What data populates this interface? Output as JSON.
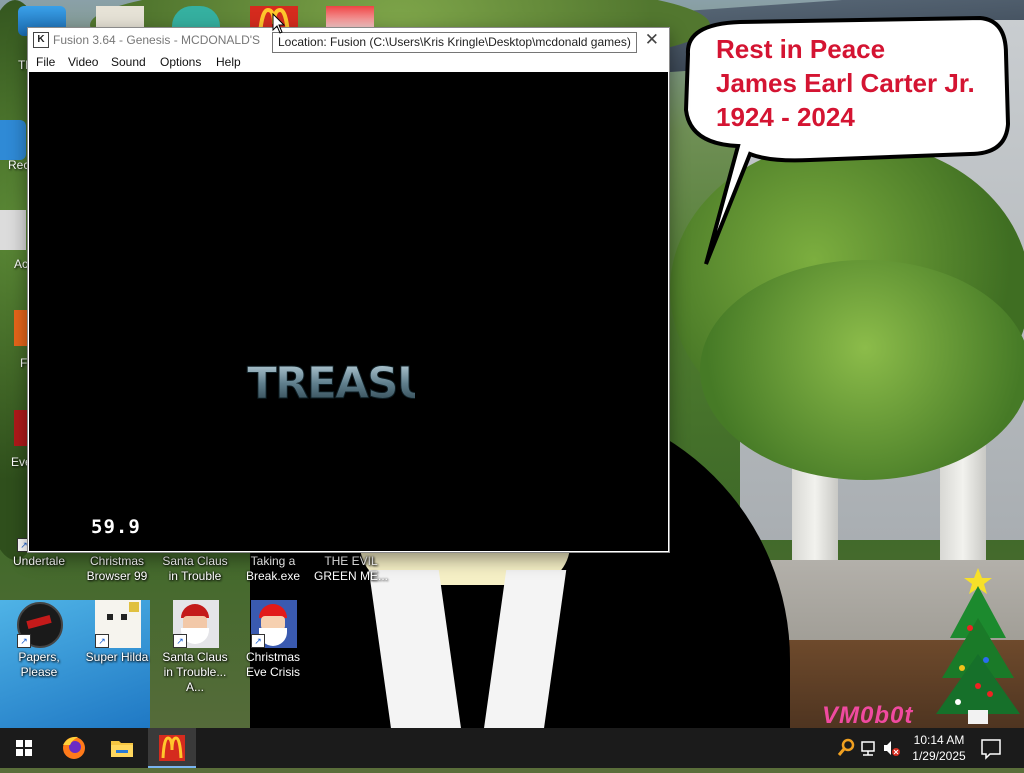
{
  "speech_bubble": {
    "line1": "Rest in Peace",
    "line2": "James Earl Carter Jr.",
    "line3": "1924 - 2024"
  },
  "wallpaper": {
    "corner_mark": "VM0b0t"
  },
  "fusion_window": {
    "title": "Fusion 3.64 - Genesis - MCDONALD'S",
    "menu": [
      "File",
      "Video",
      "Sound",
      "Options",
      "Help"
    ],
    "fps": "59.9",
    "logo_text": "TREASU"
  },
  "tooltip": {
    "text": "Location: Fusion (C:\\Users\\Kris Kringle\\Desktop\\mcdonald games)"
  },
  "desktop_icons": [
    {
      "label": "Undertale",
      "icon": "undertale-icon"
    },
    {
      "label": "Christmas Browser 99",
      "icon": "browser-icon"
    },
    {
      "label": "Santa Claus in Trouble",
      "icon": "game-icon"
    },
    {
      "label": "Taking a Break.exe",
      "icon": "game-icon"
    },
    {
      "label": "THE EVIL GREEN ME...",
      "icon": "game-icon"
    },
    {
      "label": "Papers, Please",
      "icon": "papers-please-icon"
    },
    {
      "label": "Super Hilda",
      "icon": "super-hilda-icon"
    },
    {
      "label": "Santa Claus in Trouble... A...",
      "icon": "santa-icon"
    },
    {
      "label": "Christmas Eve Crisis",
      "icon": "santa-icon"
    }
  ],
  "left_edge_labels": [
    "Tl",
    "Rec",
    "Ac",
    "F",
    "Eve"
  ],
  "taskbar": {
    "time": "10:14 AM",
    "date": "1/29/2025",
    "apps": [
      "start-icon",
      "firefox-icon",
      "file-explorer-icon",
      "mcdonalds-icon"
    ]
  },
  "colors": {
    "bubble_text": "#d41432",
    "taskbar": "#1b1b1b",
    "mcdonalds_red": "#d52b1e",
    "mcdonalds_yellow": "#ffc72c"
  }
}
